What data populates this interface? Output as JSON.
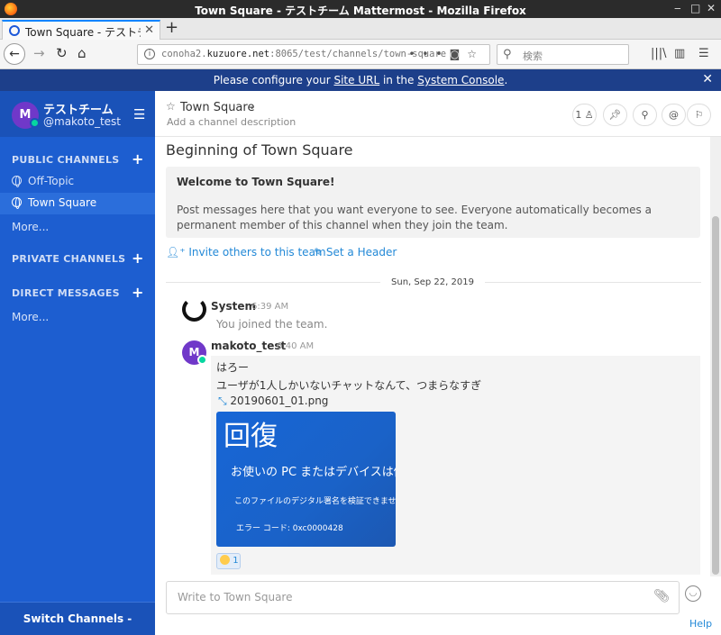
{
  "window": {
    "title": "Town Square - テストチーム  Mattermost - Mozilla Firefox"
  },
  "browser": {
    "tab_title": "Town Square - テストチーム",
    "url_host": "conoha2.",
    "url_domain": "kuzuore.net",
    "url_rest": ":8065/test/channels/town-square",
    "search_placeholder": "検索"
  },
  "banner": {
    "pre": "Please configure your ",
    "link1": "Site URL",
    "mid": " in the ",
    "link2": "System Console",
    "post": "."
  },
  "sidebar": {
    "avatar_letter": "M",
    "team_name": "テストチーム",
    "username": "@makoto_test",
    "public_label": "PUBLIC CHANNELS",
    "public_items": [
      {
        "label": "Off-Topic"
      },
      {
        "label": "Town Square"
      }
    ],
    "public_more": "More...",
    "private_label": "PRIVATE CHANNELS",
    "direct_label": "DIRECT MESSAGES",
    "direct_more": "More...",
    "footer": "Switch Channels - CTRL+K"
  },
  "channel": {
    "name": "Town Square",
    "description": "Add a channel description",
    "member_count": "1"
  },
  "intro": {
    "title": "Beginning of Town Square",
    "welcome_title": "Welcome to Town Square!",
    "welcome_text": "Post messages here that you want everyone to see. Everyone automatically becomes a permanent member of this channel when they join the team.",
    "invite_link": "Invite others to this team",
    "header_link": "Set a Header"
  },
  "date_separator": "Sun, Sep 22, 2019",
  "posts": [
    {
      "user": "System",
      "time": "6:39 AM",
      "message": "You joined the team."
    },
    {
      "user": "makoto_test",
      "avatar_letter": "M",
      "time": "6:40 AM",
      "lines": [
        "はろー",
        "ユーザが1人しかいないチャットなんて、つまらなすぎ"
      ],
      "attachment": "20190601_01.png",
      "thumb_lines": [
        "回復",
        "お使いの PC またはデバイスは修",
        "このファイルのデジタル署名を検証できませ",
        "エラー コード: 0xc0000428"
      ],
      "reaction_count": "1"
    }
  ],
  "input": {
    "placeholder": "Write to Town Square"
  },
  "help": "Help"
}
